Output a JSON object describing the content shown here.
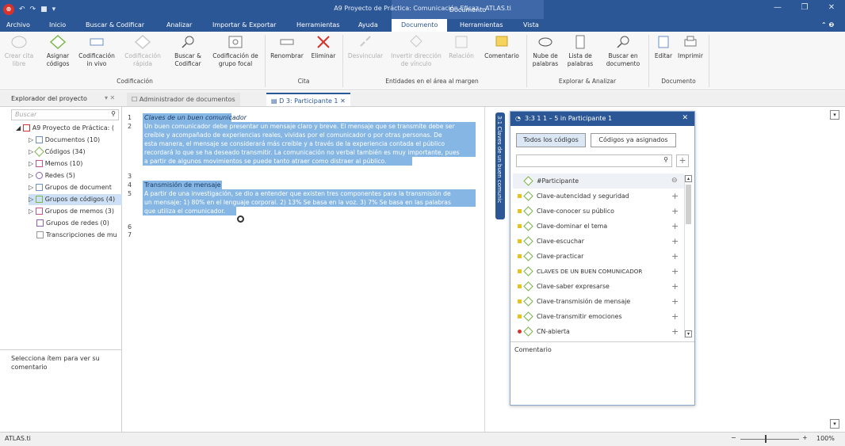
{
  "window": {
    "title": "A9 Proyecto de Práctica: Comunicación Eficaz - ATLAS.ti",
    "context_group": "Documento"
  },
  "menu": [
    "Archivo",
    "Inicio",
    "Buscar & Codificar",
    "Analizar",
    "Importar & Exportar",
    "Herramientas",
    "Ayuda",
    "Documento",
    "Herramientas",
    "Vista"
  ],
  "ribbon": {
    "crear_cita": "Crear cita libre",
    "asignar": "Asignar códigos",
    "in_vivo": "Codificación in vivo",
    "rapida": "Codificación rápida",
    "buscar_codificar": "Buscar & Codificar",
    "grupo_focal": "Codificación de grupo focal",
    "group_codificacion": "Codificación",
    "renombrar": "Renombrar",
    "eliminar": "Eliminar",
    "group_cita": "Cita",
    "desvincular": "Desvincular",
    "invertir": "Invertir dirección de vínculo",
    "relacion": "Relación",
    "comentario": "Comentario",
    "group_entidades": "Entidades en el área al margen",
    "nube": "Nube de palabras",
    "lista": "Lista de palabras",
    "buscar_doc": "Buscar en documento",
    "group_explorar": "Explorar & Analizar",
    "editar": "Editar",
    "imprimir": "Imprimir",
    "group_documento": "Documento"
  },
  "explorer": {
    "title": "Explorador del proyecto",
    "search_placeholder": "Buscar",
    "items": [
      "A9 Proyecto de Práctica: (",
      "Documentos (10)",
      "Códigos (34)",
      "Memos (10)",
      "Redes (5)",
      "Grupos de document",
      "Grupos de códigos (4)",
      "Grupos de memos (3)",
      "Grupos de redes (0)",
      "Transcripciones de mu"
    ],
    "comment_hint": "Selecciona ítem para ver su comentario"
  },
  "tabs": {
    "docs_manager": "Administrador de documentos",
    "current": "D 3: Participante 1"
  },
  "document": {
    "line_numbers": [
      "1",
      "2",
      "3",
      "4",
      "5",
      "6",
      "7"
    ],
    "lines": [
      "Claves de un buen comunicador",
      "Un buen comunicador debe presentar un mensaje claro y breve. El mensaje que se transmite debe ser",
      "creíble y  acompañado de experiencias reales, vividas por el comunicador o por otras personas. De",
      "esta manera, el mensaje se considerará más creíble y a través de la experiencia contada el público",
      "recordará lo que se ha deseado transmitir. La comunicación no verbal también es muy importante, pues",
      "a partir de algunos movimientos se puede tanto atraer como distraer al público.",
      "",
      "Transmisión de mensaje",
      "A partir de una investigación, se dio a entender que existen tres componentes para la transmisión de",
      "un mensaje: 1) 80% en el lenguaje corporal. 2) 13% Se basa en la voz. 3) 7% Se basa en las palabras",
      "que utiliza el comunicador."
    ]
  },
  "margin": {
    "bracket_label": "3:1 Claves de un buen comunic"
  },
  "popup": {
    "title": "3:3 1 1 – 5 in Participante 1",
    "tab_all": "Todos los códigos",
    "tab_assigned": "Códigos ya asignados",
    "codes": [
      "#Participante",
      "Clave-autencidad y seguridad",
      "Clave-conocer su público",
      "Clave-dominar el tema",
      "Clave-escuchar",
      "Clave-practicar",
      "CLAVES DE UN BUEN COMUNICADOR",
      "Clave-saber expresarse",
      "Clave-transmisión de mensaje",
      "Clave-transmitir emociones",
      "CN-abierta"
    ],
    "comment_label": "Comentario"
  },
  "status": {
    "app": "ATLAS.ti",
    "zoom": "100%"
  },
  "colors": {
    "accent": "#2b5797",
    "highlight": "#86b7e4",
    "code_yellow": "#e8c21a",
    "code_red": "#d9322c"
  }
}
